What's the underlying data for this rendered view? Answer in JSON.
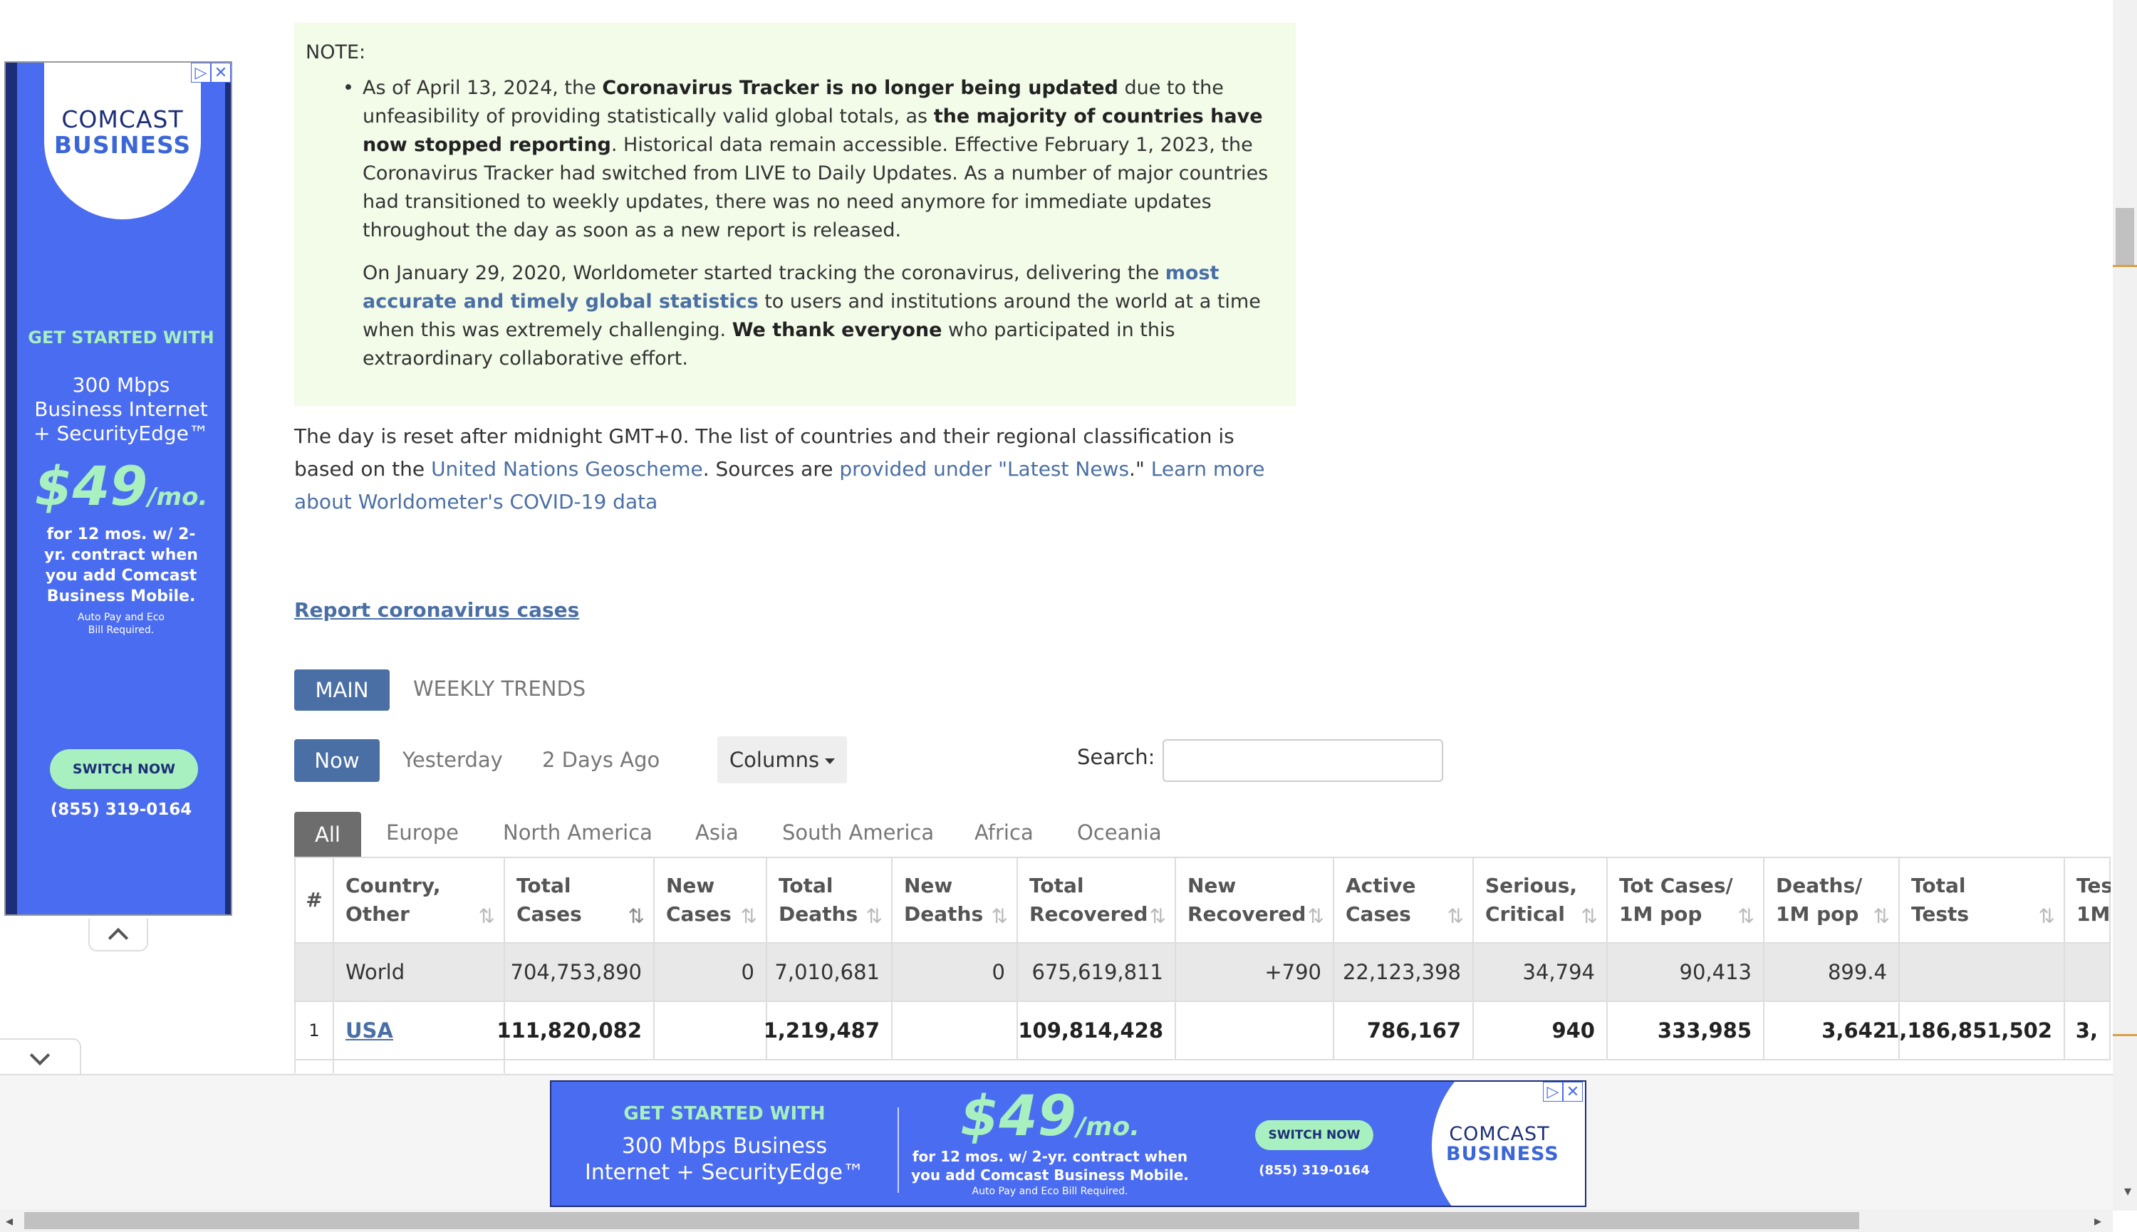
{
  "note": {
    "title": "NOTE:",
    "bullet_p1_a": "As of April 13, 2024, the ",
    "bullet_p1_b": "Coronavirus Tracker is no longer being updated",
    "bullet_p1_c": " due to the unfeasibility of providing statistically valid global totals, as ",
    "bullet_p1_d": "the majority of countries have now stopped reporting",
    "bullet_p1_e": ". Historical data remain accessible. Effective February 1, 2023, the Coronavirus Tracker had switched from LIVE to Daily Updates. As a number of major countries had transitioned to weekly updates, there was no need anymore for immediate updates throughout the day as soon as a new report is released.",
    "bullet_p2_a": "On January 29, 2020, Worldometer started tracking the coronavirus, delivering the ",
    "bullet_p2_link": "most accurate and timely global statistics",
    "bullet_p2_b": " to users and institutions around the world at a time when this was extremely challenging. ",
    "bullet_p2_c": "We thank everyone",
    "bullet_p2_d": " who participated in this extraordinary collaborative effort."
  },
  "info": {
    "text_a": "The day is reset after midnight GMT+0. The list of countries and their regional classification is based on the ",
    "link_un": "United Nations Geoscheme",
    "text_b": ". Sources are ",
    "link_sources": "provided under \"Latest News",
    "text_c": ".\" ",
    "link_learn": "Learn more about Worldometer's COVID-19 data"
  },
  "report_link": "Report coronavirus cases",
  "view_tabs": {
    "main": "MAIN",
    "weekly": "WEEKLY TRENDS"
  },
  "day_tabs": {
    "now": "Now",
    "yesterday": "Yesterday",
    "two_days": "2 Days Ago"
  },
  "columns_label": "Columns",
  "search_label": "Search:",
  "search_value": "",
  "regions": [
    "All",
    "Europe",
    "North America",
    "Asia",
    "South America",
    "Africa",
    "Oceania"
  ],
  "table": {
    "headers": [
      {
        "l1": "#",
        "l2": ""
      },
      {
        "l1": "Country,",
        "l2": "Other"
      },
      {
        "l1": "Total",
        "l2": "Cases"
      },
      {
        "l1": "New",
        "l2": "Cases"
      },
      {
        "l1": "Total",
        "l2": "Deaths"
      },
      {
        "l1": "New",
        "l2": "Deaths"
      },
      {
        "l1": "Total",
        "l2": "Recovered"
      },
      {
        "l1": "New",
        "l2": "Recovered"
      },
      {
        "l1": "Active",
        "l2": "Cases"
      },
      {
        "l1": "Serious,",
        "l2": "Critical"
      },
      {
        "l1": "Tot Cases/",
        "l2": "1M pop"
      },
      {
        "l1": "Deaths/",
        "l2": "1M pop"
      },
      {
        "l1": "Total",
        "l2": "Tests"
      },
      {
        "l1": "Tes",
        "l2": "1M"
      }
    ],
    "world": [
      "",
      "World",
      "704,753,890",
      "0",
      "7,010,681",
      "0",
      "675,619,811",
      "+790",
      "22,123,398",
      "34,794",
      "90,413",
      "899.4",
      "",
      ""
    ],
    "usa": [
      "1",
      "USA",
      "111,820,082",
      "",
      "1,219,487",
      "",
      "109,814,428",
      "",
      "786,167",
      "940",
      "333,985",
      "3,642",
      "1,186,851,502",
      "3,"
    ]
  },
  "ad_left": {
    "brand_line1": "COMCAST",
    "brand_line2": "BUSINESS",
    "cta": "GET STARTED WITH",
    "speed": "300 Mbps Business Internet + SecurityEdge™",
    "price": "$49",
    "per": "/mo.",
    "terms": "for 12 mos. w/ 2-yr. contract when you add Comcast Business Mobile.",
    "fine": "Auto Pay and Eco Bill Required.",
    "button": "SWITCH NOW",
    "phone": "(855) 319-0164"
  },
  "ad_bottom": {
    "cta": "GET STARTED WITH",
    "speed": "300 Mbps Business Internet + SecurityEdge™",
    "price": "$49",
    "per": "/mo.",
    "terms": "for 12 mos. w/ 2-yr. contract when you add Comcast Business Mobile.",
    "fine": "Auto Pay and Eco Bill Required.",
    "button": "SWITCH NOW",
    "phone": "(855) 319-0164",
    "brand_line1": "COMCAST",
    "brand_line2": "BUSINESS"
  },
  "colors": {
    "accent": "#4a6fa5",
    "note_bg": "#f3fce9",
    "ad_blue": "#4a6cf0",
    "ad_navy": "#1d2e78"
  }
}
